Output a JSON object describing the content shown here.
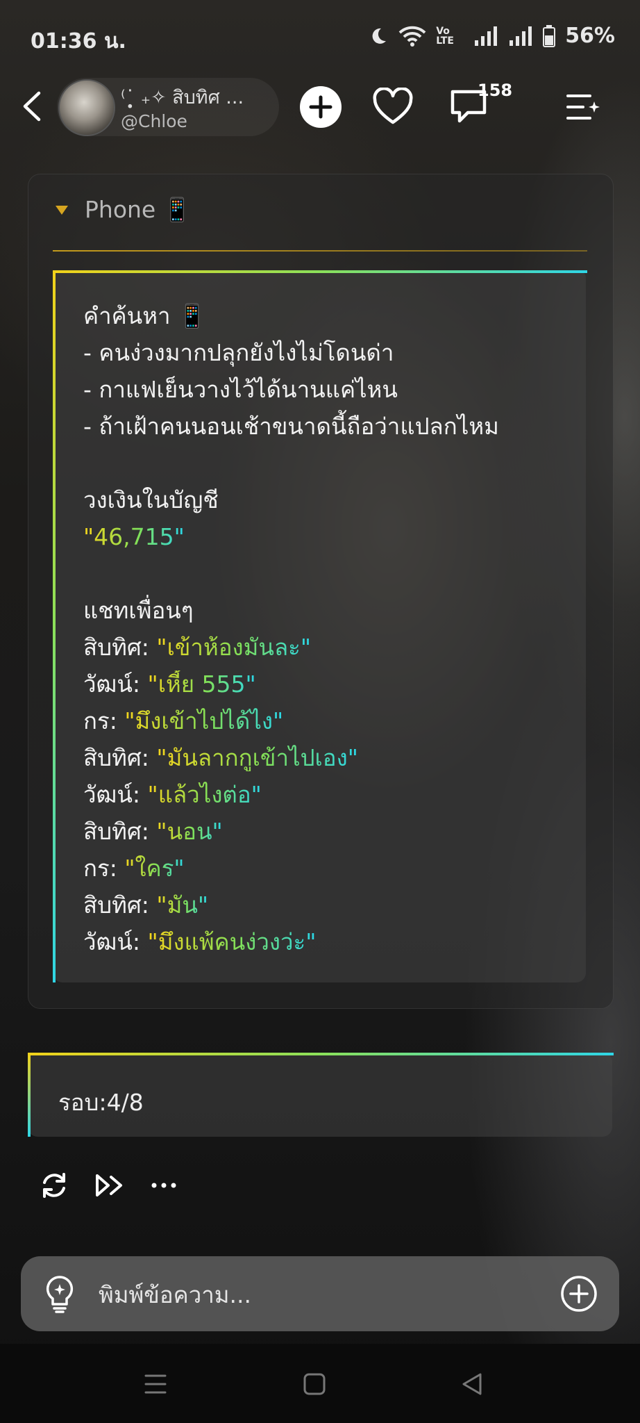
{
  "status_bar": {
    "time": "01:36 น.",
    "network": "Vo LTE",
    "battery": "56%"
  },
  "header": {
    "character_name": "⁽˙̣̥̇ ₊✧ สิบทิศ ...",
    "handle": "@Chloe",
    "comment_count": "158"
  },
  "card": {
    "section_title": "Phone 📱",
    "lines": [
      {
        "text": "คำค้นหา 📱"
      },
      {
        "text": "- คนง่วงมากปลุกยังไงไม่โดนด่า"
      },
      {
        "text": "- กาแฟเย็นวางไว้ได้นานแค่ไหน"
      },
      {
        "text": "- ถ้าเฝ้าคนนอนเช้าขนาดนี้ถือว่าแปลกไหม"
      },
      {
        "text": ""
      },
      {
        "text": "วงเงินในบัญชี"
      },
      {
        "highlight": "\"46,715\""
      },
      {
        "text": ""
      },
      {
        "text": "แชทเพื่อนๆ"
      },
      {
        "speaker": "สิบทิศ: ",
        "highlight": "\"เข้าห้องมันละ\""
      },
      {
        "speaker": "วัฒน์: ",
        "highlight": "\"เหี้ย 555\""
      },
      {
        "speaker": "กร: ",
        "highlight": "\"มึงเข้าไปได้ไง\""
      },
      {
        "speaker": "สิบทิศ: ",
        "highlight": "\"มันลากกูเข้าไปเอง\""
      },
      {
        "speaker": "วัฒน์: ",
        "highlight": "\"แล้วไงต่อ\""
      },
      {
        "speaker": "สิบทิศ: ",
        "highlight": "\"นอน\""
      },
      {
        "speaker": "กร: ",
        "highlight": "\"ใคร\""
      },
      {
        "speaker": "สิบทิศ: ",
        "highlight": "\"มัน\""
      },
      {
        "speaker": "วัฒน์: ",
        "highlight": "\"มึงแพ้คนง่วงว่ะ\""
      }
    ]
  },
  "rounds": {
    "text": "รอบ:4/8"
  },
  "input": {
    "placeholder": "พิมพ์ข้อความ..."
  },
  "icons": {
    "back": "chevron-left-icon",
    "add": "plus-icon",
    "like": "heart-icon",
    "comments": "comment-icon",
    "menu": "menu-sparkle-icon",
    "regenerate": "refresh-icon",
    "continue": "fast-forward-icon",
    "more": "more-icon",
    "idea": "lightbulb-icon",
    "attach": "plus-circle-icon"
  },
  "colors": {
    "accent_gold": "#d6a520",
    "gradient_start": "#f2d21a",
    "gradient_end": "#2fd6e6"
  }
}
